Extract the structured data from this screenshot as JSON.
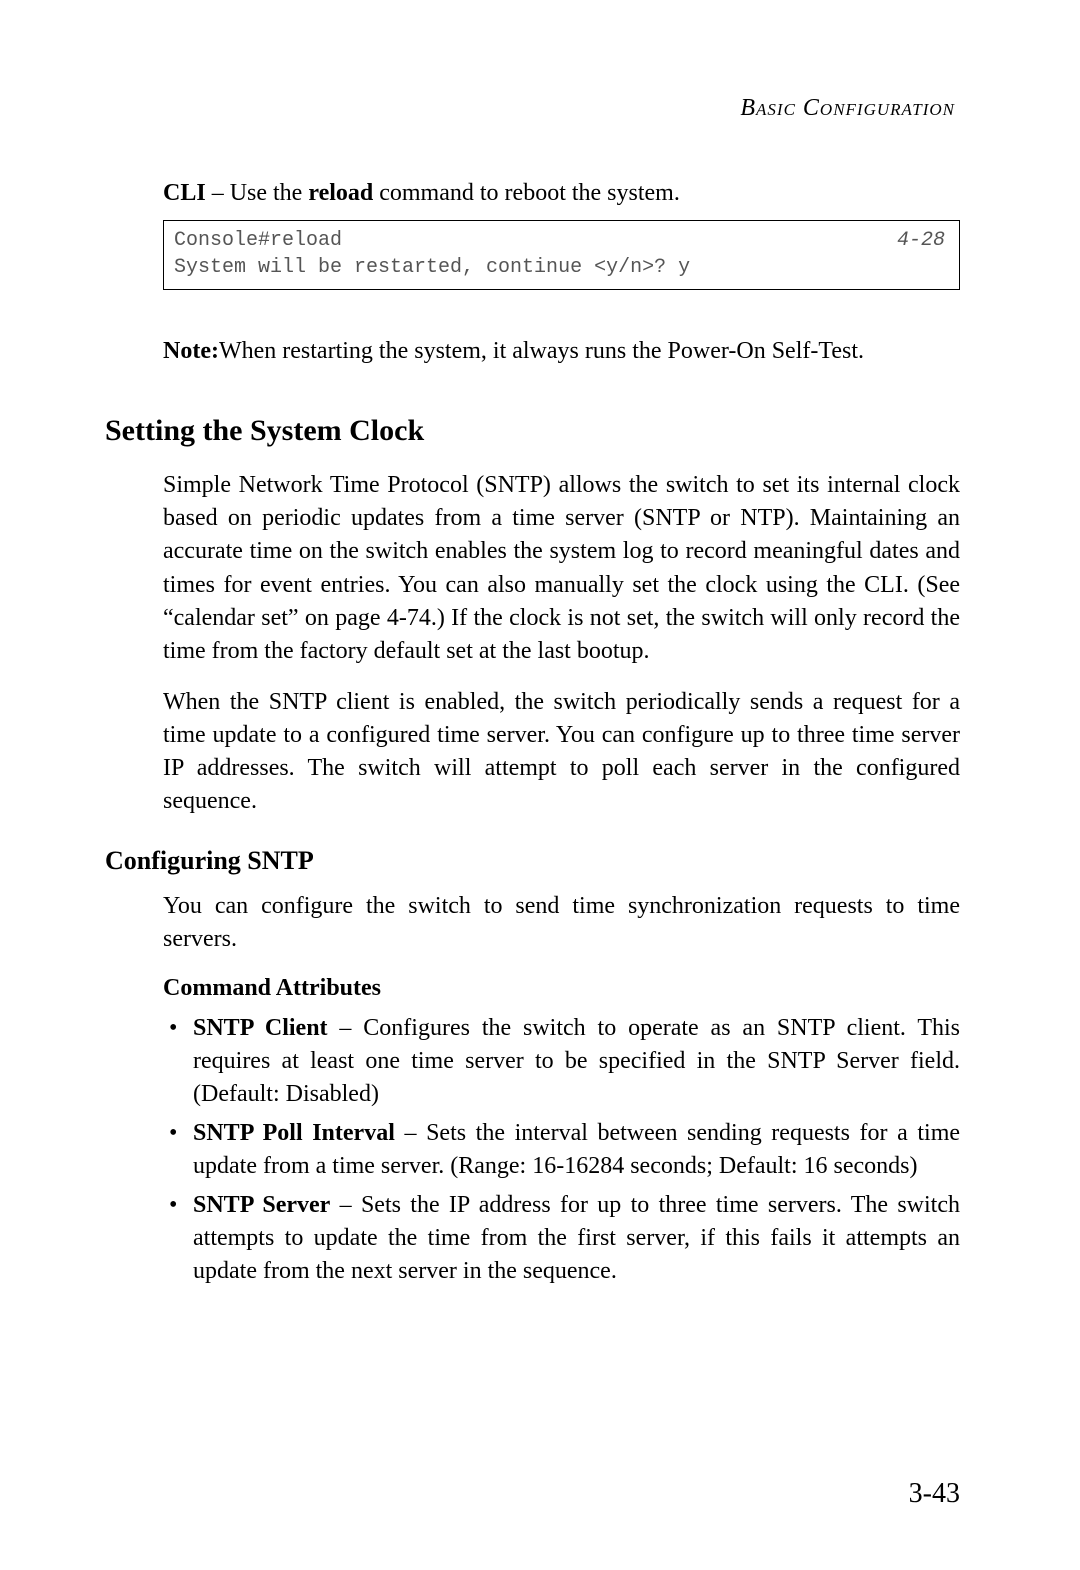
{
  "header": {
    "running_head": "Basic Configuration"
  },
  "intro": {
    "cli_label": "CLI",
    "cli_sep": " – Use the ",
    "cli_cmd": "reload",
    "cli_rest": " command to reboot the system."
  },
  "code": {
    "line1": "Console#reload",
    "line2": "System will be restarted, continue <y/n>? y",
    "ref": "4-28"
  },
  "note": {
    "label": "Note:",
    "text": "When restarting the system, it always runs the Power-On Self-Test."
  },
  "section": {
    "title": "Setting the System Clock",
    "p1": "Simple Network Time Protocol (SNTP) allows the switch to set its internal clock based on periodic updates from a time server (SNTP or NTP). Maintaining an accurate time on the switch enables the system log to record meaningful dates and times for event entries. You can also manually set the clock using the CLI. (See “calendar set” on page 4-74.) If the clock is not set, the switch will only record the time from the factory default set at the last bootup.",
    "p2": "When the SNTP client is enabled, the switch periodically sends a request for a time update to a configured time server. You can configure up to three time server IP addresses. The switch will attempt to poll each server in the configured sequence."
  },
  "subsection": {
    "title": "Configuring SNTP",
    "p1": "You can configure the switch to send time synchronization requests to time servers."
  },
  "attrs": {
    "title": "Command Attributes",
    "items": [
      {
        "name": "SNTP Client",
        "sep": " – ",
        "desc": "Configures the switch to operate as an SNTP client. This requires at least one time server to be specified in the SNTP Server field. (Default: Disabled)"
      },
      {
        "name": "SNTP Poll Interval",
        "sep": " – ",
        "desc": "Sets the interval between sending requests for a time update from a time server. (Range: 16-16284 seconds; Default: 16 seconds)"
      },
      {
        "name": "SNTP Server",
        "sep": " – ",
        "desc": "Sets the IP address for up to three time servers. The switch attempts to update the time from the first server, if this fails it attempts an update from the next server in the sequence."
      }
    ]
  },
  "page_number": "3-43"
}
